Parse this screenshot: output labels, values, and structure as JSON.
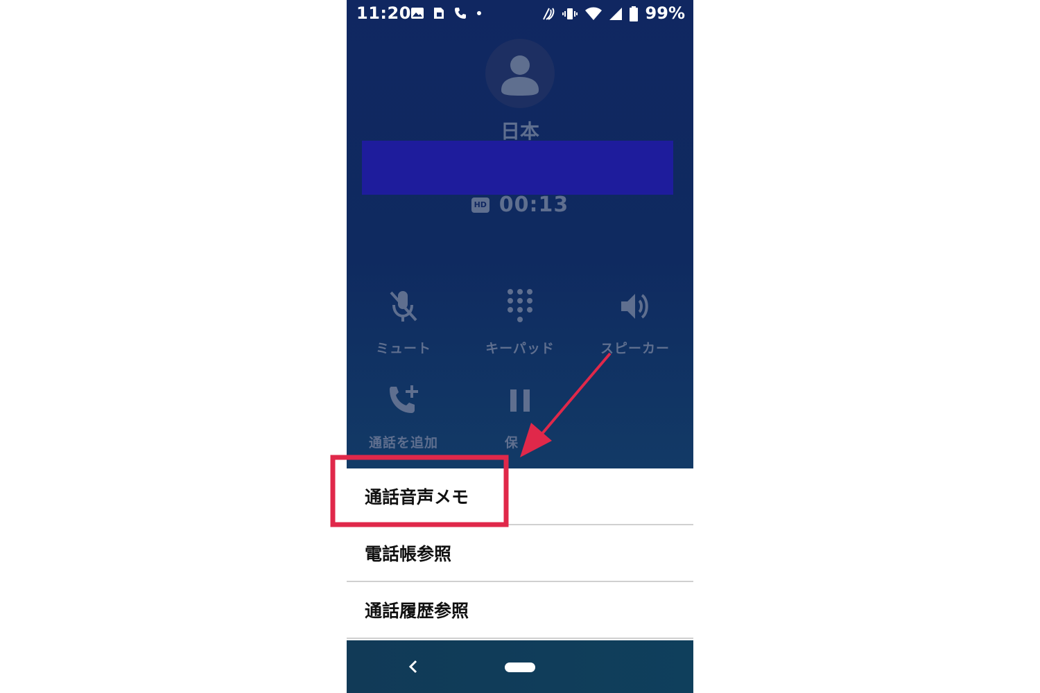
{
  "status_bar": {
    "time": "11:20",
    "battery": "99%",
    "left_icons": [
      "image-icon",
      "sim-card-icon",
      "phone-icon",
      "dot-icon"
    ],
    "right_icons": [
      "nfc-icon",
      "vibrate-icon",
      "wifi-icon",
      "signal-icon",
      "battery-icon"
    ]
  },
  "call": {
    "caller_label": "日本",
    "hd_badge": "HD",
    "duration": "00:13"
  },
  "controls": [
    {
      "label": "ミュート",
      "icon": "mic-off-icon"
    },
    {
      "label": "キーパッド",
      "icon": "dialpad-icon"
    },
    {
      "label": "スピーカー",
      "icon": "speaker-icon"
    },
    {
      "label": "通話を追加",
      "icon": "add-call-icon"
    },
    {
      "label": "保",
      "icon": "pause-icon"
    }
  ],
  "menu": {
    "items": [
      "通話音声メモ",
      "電話帳参照",
      "通話履歴参照"
    ]
  },
  "colors": {
    "call_background": "#102761",
    "dim_foreground": "#5f6f8f",
    "redaction": "#1e1c9c",
    "annotation": "#e0284a"
  }
}
